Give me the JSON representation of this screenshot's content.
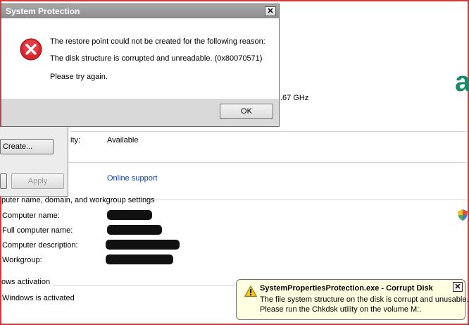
{
  "dialog": {
    "title": "System Protection",
    "close_glyph": "✕",
    "message_line1": "The restore point could not be created for the following reason:",
    "message_line2": "The disk structure is corrupted and unreadable. (0x80070571)",
    "message_line3": "Please try again.",
    "ok_label": "OK",
    "icon": "error-icon"
  },
  "panel": {
    "create_label": "Create...",
    "apply_label": "Apply"
  },
  "background": {
    "processor_speed": ".67 GHz",
    "availability_label": "ity:",
    "availability_value": "Available",
    "support_link": "Online support",
    "section_computer": "puter name, domain, and workgroup settings",
    "computer_name_label": "Computer name:",
    "full_computer_name_label": "Full computer name:",
    "computer_description_label": "Computer description:",
    "workgroup_label": "Workgroup:",
    "section_activation": "ows activation",
    "activation_status": "Windows is activated",
    "logo_fragment": "a"
  },
  "balloon": {
    "title": "SystemPropertiesProtection.exe - Corrupt Disk",
    "line1": "The file system structure on the disk is corrupt and unusable.",
    "line2": "Please run the Chkdsk utility on the volume M:.",
    "close_glyph": "✕",
    "icon": "warning-icon"
  },
  "colors": {
    "frame_border": "#d23a3a",
    "link": "#0a3ea8",
    "balloon_bg": "#ffffe1",
    "error_red": "#d9262c"
  }
}
